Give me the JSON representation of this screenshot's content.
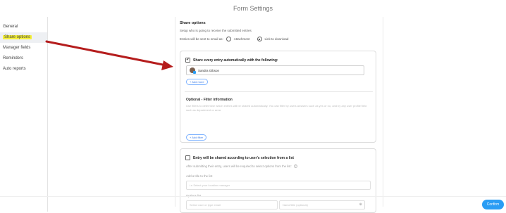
{
  "window": {
    "title": "Form Settings"
  },
  "sidebar": {
    "items": [
      {
        "label": "General"
      },
      {
        "label": "Share options"
      },
      {
        "label": "Manager fields"
      },
      {
        "label": "Reminders"
      },
      {
        "label": "Auto reports"
      }
    ],
    "active_index": 1
  },
  "share": {
    "title": "Share options",
    "description": "Setup who is going to receive the submitted entries",
    "email_prefix": "Entries will be sent to email as:",
    "radio_attachment": "Attachment",
    "radio_link": "Link to download",
    "selected_radio": "Link to download"
  },
  "card1": {
    "checkbox_checked": true,
    "heading": "Share every entry automatically with the following:",
    "user_name": "Sandra Gibson",
    "add_more": "+ Add more",
    "optional_title": "Optional - Filter information",
    "optional_desc": "Use filters to determine which entries will be shared automatically. You can filter by users answers such as yes or no, and by any user profile field such as department or area",
    "add_filter": "+ Add filter"
  },
  "card2": {
    "checkbox_checked": false,
    "heading": "Entry will be shared according to user's selection from a list",
    "subtext": "After submitting their entry, users will be required to select options from the list:",
    "title_label": "Add a title to the list",
    "title_placeholder": "i.e Select your location manager",
    "options_label": "Options list",
    "option_placeholder_1": "Select user or type email",
    "option_placeholder_2": "Name/title (optional)"
  },
  "footer": {
    "confirm_label": "Confirm"
  },
  "colors": {
    "accent": "#2a9df4",
    "highlight": "#f4ef3a",
    "annotation_arrow": "#b51d1d"
  }
}
